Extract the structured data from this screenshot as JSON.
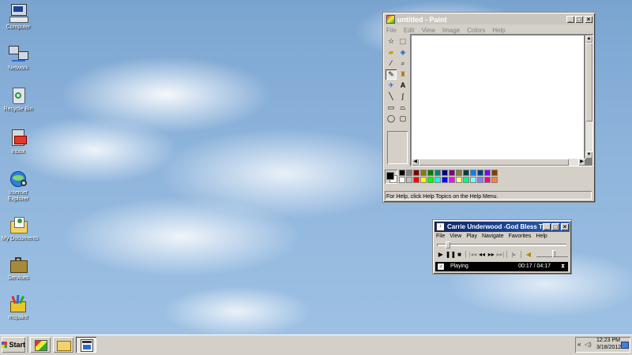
{
  "desktop": {
    "icons": [
      {
        "label": "Computer"
      },
      {
        "label": "Network"
      },
      {
        "label": "Recycle Bin"
      },
      {
        "label": "Inbox"
      },
      {
        "label": "Internet Explorer"
      },
      {
        "label": "My Documents"
      },
      {
        "label": "Services"
      },
      {
        "label": "mspaint"
      }
    ]
  },
  "paint": {
    "title": "untitled - Paint",
    "menu": [
      "File",
      "Edit",
      "View",
      "Image",
      "Colors",
      "Help"
    ],
    "status": "For Help, click Help Topics on the Help Menu.",
    "palette_top": [
      "#000000",
      "#808080",
      "#800000",
      "#808000",
      "#008000",
      "#008080",
      "#000080",
      "#800080",
      "#808040",
      "#004040",
      "#0080ff",
      "#004080",
      "#8000ff",
      "#804000"
    ],
    "palette_bottom": [
      "#ffffff",
      "#c0c0c0",
      "#ff0000",
      "#ffff00",
      "#00ff00",
      "#00ffff",
      "#0000ff",
      "#ff00ff",
      "#ffff80",
      "#00ff80",
      "#80ffff",
      "#8080ff",
      "#ff0080",
      "#ff8040"
    ],
    "foreground_color": "#000000",
    "background_color": "#ffffff"
  },
  "player": {
    "title": "Carrie Underwood -God Bless The Bro...",
    "menu": [
      "File",
      "View",
      "Play",
      "Navigate",
      "Favorites",
      "Help"
    ],
    "status": "Playing",
    "time": "00:17 / 04:17",
    "progress_fraction": 0.07,
    "volume_fraction": 0.55
  },
  "taskbar": {
    "start_label": "Start",
    "clock_time": "12:23 PM",
    "clock_date": "3/18/2012",
    "accent": "#0a246a"
  }
}
